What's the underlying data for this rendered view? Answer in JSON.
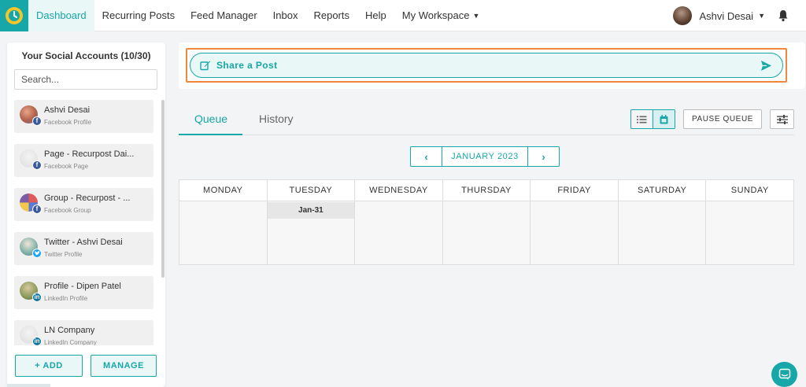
{
  "nav": {
    "items": [
      {
        "label": "Dashboard",
        "active": true
      },
      {
        "label": "Recurring Posts"
      },
      {
        "label": "Feed Manager"
      },
      {
        "label": "Inbox"
      },
      {
        "label": "Reports"
      },
      {
        "label": "Help"
      },
      {
        "label": "My Workspace"
      }
    ],
    "user_name": "Ashvi Desai"
  },
  "sidebar": {
    "title": "Your Social Accounts (10/30)",
    "search_placeholder": "Search...",
    "accounts": [
      {
        "name": "Ashvi Desai",
        "type": "Facebook Profile",
        "network": "facebook",
        "badge_color": "#3b5998"
      },
      {
        "name": "Page - Recurpost Dai...",
        "type": "Facebook Page",
        "network": "facebook",
        "badge_color": "#3b5998"
      },
      {
        "name": "Group - Recurpost - ...",
        "type": "Facebook Group",
        "network": "facebook",
        "badge_color": "#3b5998"
      },
      {
        "name": "Twitter - Ashvi Desai",
        "type": "Twitter Profile",
        "network": "twitter",
        "badge_color": "#1da1f2"
      },
      {
        "name": "Profile - Dipen Patel",
        "type": "LinkedIn Profile",
        "network": "linkedin",
        "badge_color": "#0e76a8"
      },
      {
        "name": "LN Company",
        "type": "LinkedIn Company",
        "network": "linkedin",
        "badge_color": "#0e76a8"
      }
    ],
    "add_label": "+ ADD",
    "manage_label": "MANAGE"
  },
  "share": {
    "label": "Share a Post"
  },
  "tabs": [
    {
      "label": "Queue",
      "active": true
    },
    {
      "label": "History"
    }
  ],
  "controls": {
    "pause_label": "PAUSE QUEUE",
    "view_modes": [
      "list-view",
      "calendar-view"
    ],
    "active_view": "calendar-view"
  },
  "month_nav": {
    "label": "JANUARY 2023",
    "prev": "‹",
    "next": "›"
  },
  "calendar": {
    "days": [
      "MONDAY",
      "TUESDAY",
      "WEDNESDAY",
      "THURSDAY",
      "FRIDAY",
      "SATURDAY",
      "SUNDAY"
    ],
    "cells": [
      "",
      "Jan-31",
      "",
      "",
      "",
      "",
      ""
    ]
  },
  "colors": {
    "accent": "#17a7a8",
    "highlight": "#f0893d"
  }
}
